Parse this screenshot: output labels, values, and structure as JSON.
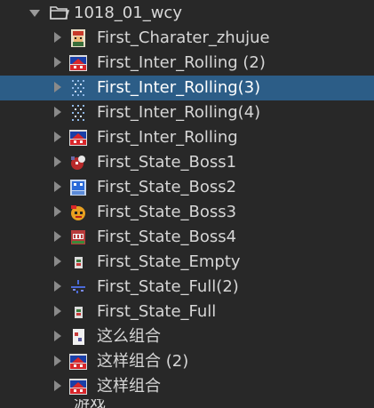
{
  "folder": {
    "name": "1018_01_wcy",
    "icon": "folder-open-icon",
    "expanded": true
  },
  "items": [
    {
      "label": "First_Charater_zhujue",
      "icon": "sprite-character-icon",
      "selected": false
    },
    {
      "label": "First_Inter_Rolling (2)",
      "icon": "sprite-red-panel-icon",
      "selected": false
    },
    {
      "label": "First_Inter_Rolling(3)",
      "icon": "sprite-dots-icon",
      "selected": true
    },
    {
      "label": "First_Inter_Rolling(4)",
      "icon": "sprite-dots-icon",
      "selected": false
    },
    {
      "label": "First_Inter_Rolling",
      "icon": "sprite-red-panel-icon",
      "selected": false
    },
    {
      "label": "First_State_Boss1",
      "icon": "sprite-boss1-icon",
      "selected": false
    },
    {
      "label": "First_State_Boss2",
      "icon": "sprite-boss2-icon",
      "selected": false
    },
    {
      "label": "First_State_Boss3",
      "icon": "sprite-boss3-icon",
      "selected": false
    },
    {
      "label": "First_State_Boss4",
      "icon": "sprite-boss4-icon",
      "selected": false
    },
    {
      "label": "First_State_Empty",
      "icon": "sprite-small-icon",
      "selected": false
    },
    {
      "label": "First_State_Full(2)",
      "icon": "sprite-scatter-icon",
      "selected": false
    },
    {
      "label": "First_State_Full",
      "icon": "sprite-small-icon",
      "selected": false
    },
    {
      "label": "这么组合",
      "icon": "sprite-card-icon",
      "selected": false
    },
    {
      "label": "这样组合 (2)",
      "icon": "sprite-red-panel-icon",
      "selected": false
    },
    {
      "label": "这样组合",
      "icon": "sprite-red-panel-icon",
      "selected": false
    }
  ],
  "partial_next": {
    "label": "游戏"
  },
  "colors": {
    "background": "#282828",
    "selection": "#2c5d87",
    "text": "#d6d6d6"
  }
}
